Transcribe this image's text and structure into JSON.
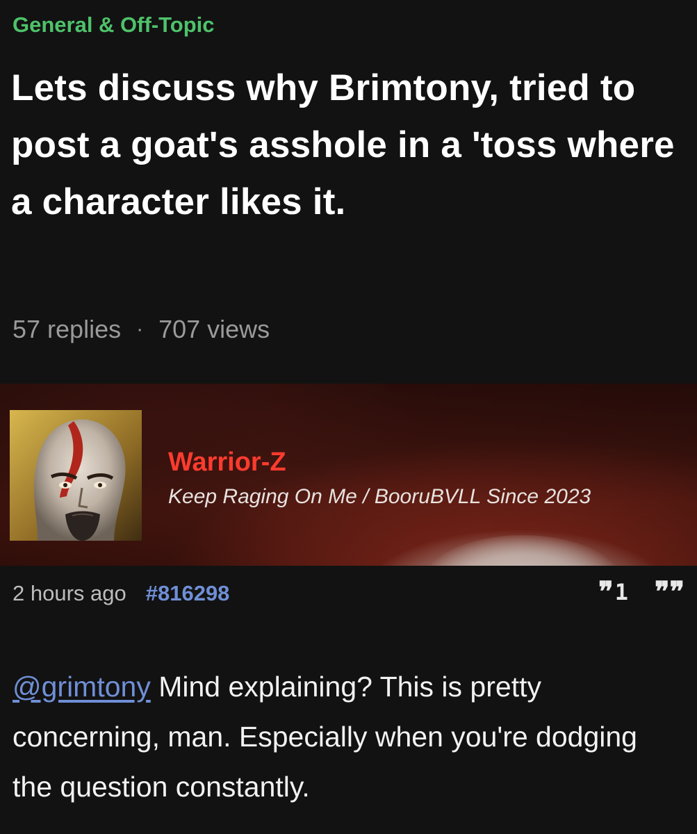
{
  "thread": {
    "category": "General & Off-Topic",
    "title": "Lets discuss why Brimtony, tried to post a goat's asshole in a 'toss where a character likes it.",
    "replies": "57 replies",
    "separator": "·",
    "views": "707 views"
  },
  "author": {
    "name": "Warrior-Z",
    "tagline": "Keep Raging On Me / BooruBVLL Since 2023",
    "avatar_icon": "kratos-avatar-icon",
    "name_color": "#ff3b2e"
  },
  "post": {
    "time": "2 hours ago",
    "number": "#816298",
    "reply_icon": "reply-quote-icon",
    "reply_count": "1",
    "quote_icon": "quote-icon",
    "mention": "@grimtony",
    "body": " Mind explaining? This is pretty concerning, man. Especially when you're dodging the question constantly."
  },
  "colors": {
    "background": "#121212",
    "category": "#4ec26a",
    "link": "#6f8fd6",
    "muted": "#9a9a9a"
  }
}
